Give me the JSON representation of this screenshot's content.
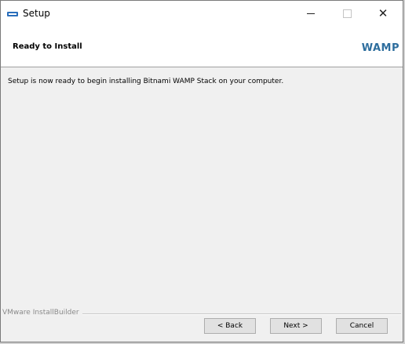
{
  "window": {
    "title": "Setup"
  },
  "header": {
    "title": "Ready to Install",
    "logo_text": "WAMP"
  },
  "content": {
    "message": "Setup is now ready to begin installing Bitnami WAMP Stack on your computer."
  },
  "footer": {
    "brand": "VMware InstallBuilder",
    "back_label": "< Back",
    "next_label": "Next >",
    "cancel_label": "Cancel"
  },
  "colors": {
    "logo": "#2e6e9e",
    "background": "#f0f0f0",
    "header_background": "#ffffff"
  }
}
